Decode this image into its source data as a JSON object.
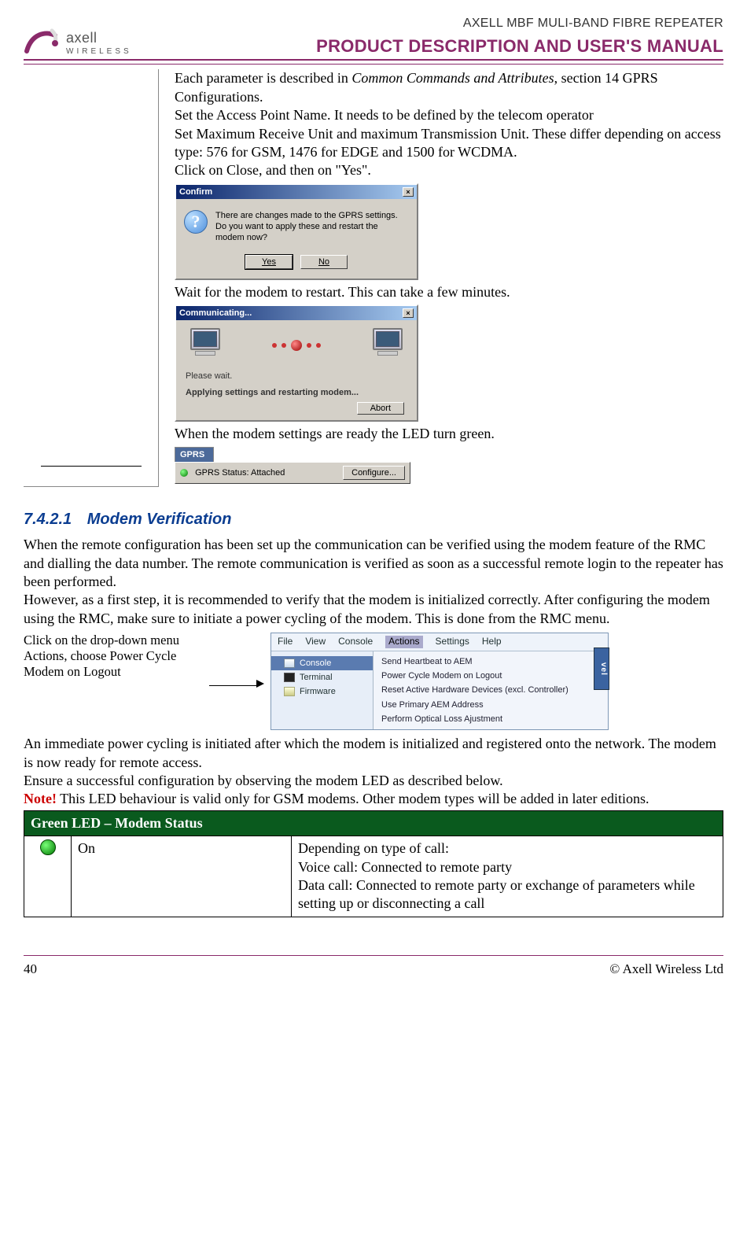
{
  "header": {
    "logo_main": "axell",
    "logo_sub": "WIRELESS",
    "product": "AXELL MBF MULI-BAND FIBRE REPEATER",
    "manual": "PRODUCT DESCRIPTION AND USER'S MANUAL"
  },
  "instr": {
    "p1a": "Each parameter is described in ",
    "p1b": "Common Commands and Attributes",
    "p1c": ", section 14 GPRS Configurations.",
    "p2": "Set the Access Point Name. It needs to be defined by the telecom operator",
    "p3": "Set Maximum Receive Unit and maximum Transmission Unit. These differ depending on access type: 576 for GSM, 1476 for EDGE and 1500 for WCDMA.",
    "p4": "Click on Close, and then on \"Yes\".",
    "p5": "Wait for the modem to restart. This can take a few minutes.",
    "p6": "When the modem settings are ready the LED turn green."
  },
  "confirm_dialog": {
    "title": "Confirm",
    "msg1": "There are changes made to the GPRS settings.",
    "msg2": "Do you want to apply these and restart the modem now?",
    "yes": "Yes",
    "no": "No"
  },
  "comm_dialog": {
    "title": "Communicating...",
    "wait": "Please wait.",
    "applying": "Applying settings and restarting modem...",
    "abort": "Abort"
  },
  "gprs": {
    "tab": "GPRS",
    "status": "GPRS Status: Attached",
    "configure": "Configure..."
  },
  "section": {
    "num": "7.4.2.1",
    "title": "Modem Verification",
    "p1": "When the remote configuration has been set up the communication can be verified using the modem feature of the RMC and dialling the data number. The remote communication is verified as soon as a successful remote login to the repeater has been performed.",
    "p2": "However, as a first step, it is recommended to verify that the modem is initialized correctly. After configuring the modem using the RMC, make sure to initiate a power cycling of the modem. This is done from the RMC menu.",
    "caption": "Click on the drop-down menu Actions, choose Power Cycle Modem on Logout",
    "menubar": [
      "File",
      "View",
      "Console",
      "Actions",
      "Settings",
      "Help"
    ],
    "tree": {
      "console": "Console",
      "terminal": "Terminal",
      "firmware": "Firmware"
    },
    "dropdown": [
      "Send Heartbeat to AEM",
      "Power Cycle Modem on Logout",
      "Reset Active Hardware Devices (excl. Controller)",
      "Use Primary AEM Address",
      "Perform Optical Loss Ajustment"
    ],
    "popup": "vel",
    "p3": "An immediate power cycling is initiated after which the modem is initialized and registered onto the network. The modem is now ready for remote access.",
    "p4": "Ensure a successful configuration by observing the modem LED as described below.",
    "note_label": "Note!",
    "note_text": " This LED behaviour is valid only for GSM modems. Other modem types will be added in later editions."
  },
  "led_table": {
    "header": "Green LED – Modem Status",
    "state": "On",
    "desc_intro": "Depending on type of call:",
    "desc_voice": "Voice call: Connected to remote party",
    "desc_data": "Data call: Connected to remote party or exchange of parameters while setting up or disconnecting a call"
  },
  "footer": {
    "page": "40",
    "copyright": "© Axell Wireless Ltd"
  }
}
